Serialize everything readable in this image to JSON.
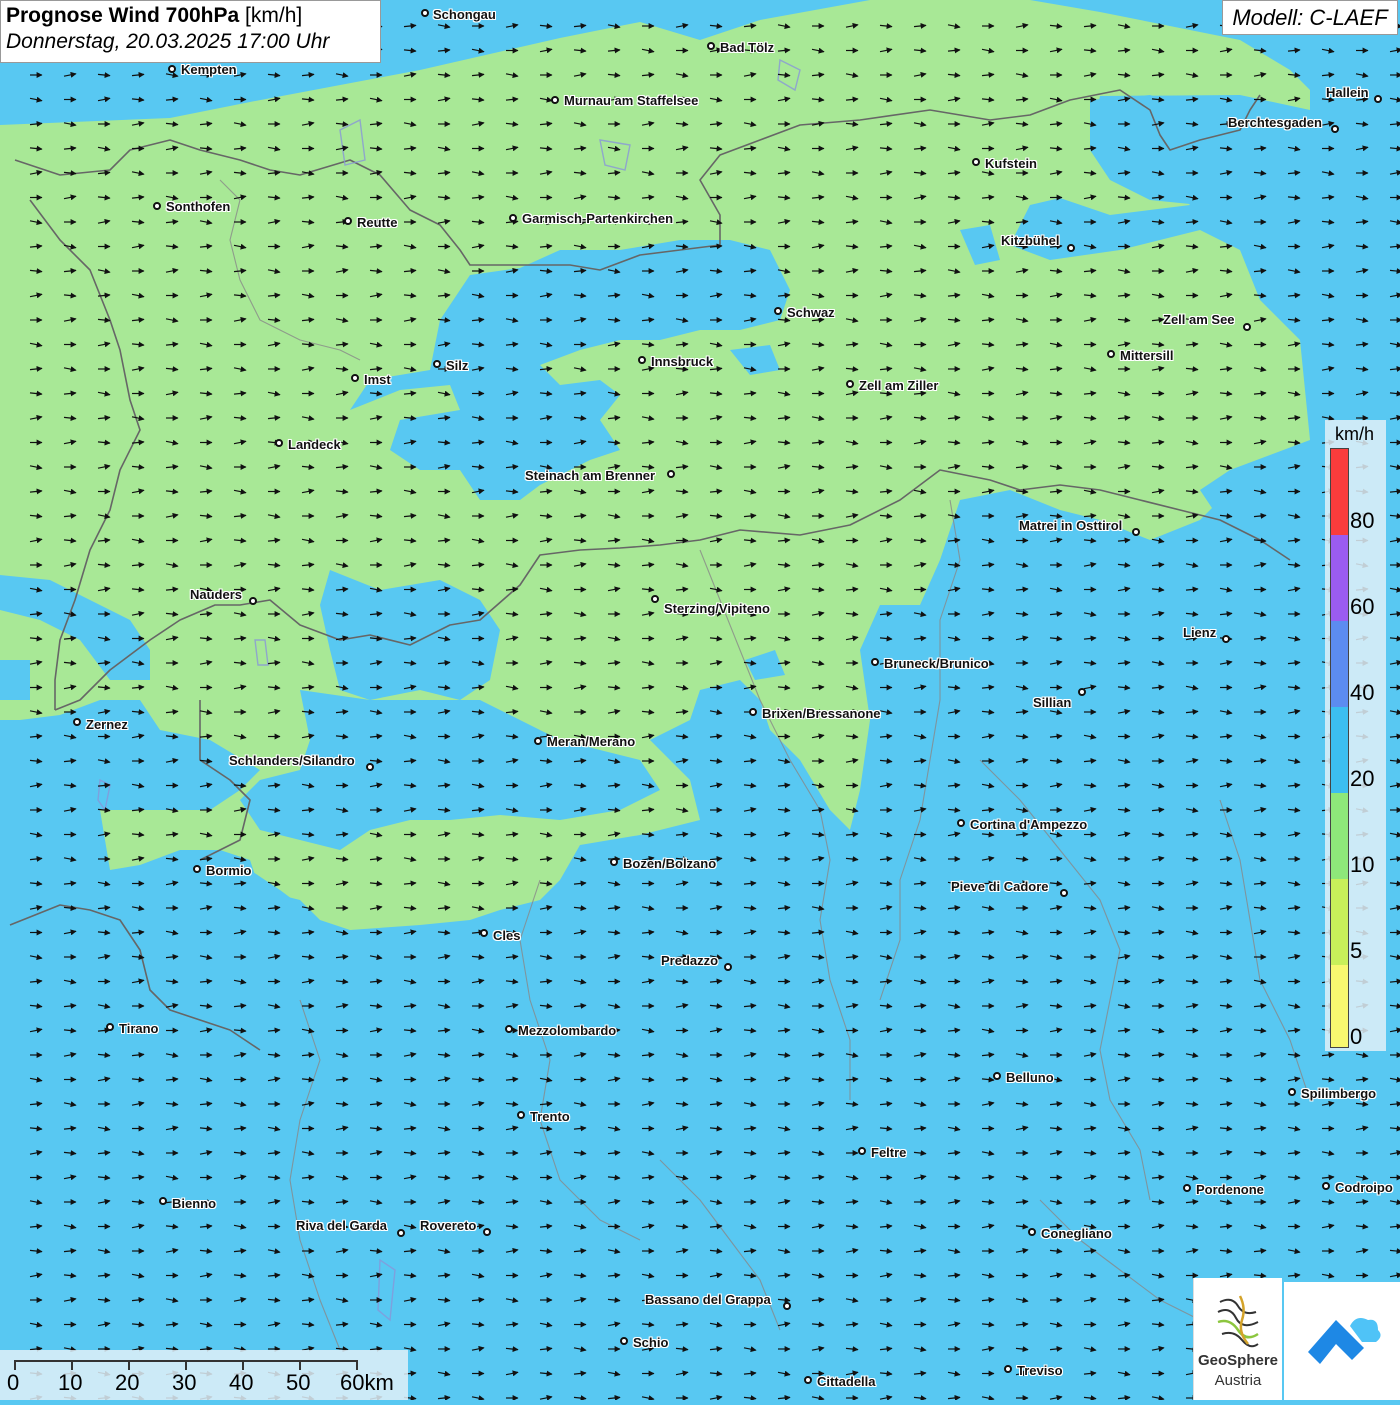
{
  "header": {
    "title_bold": "Prognose Wind 700hPa",
    "title_unit": "[km/h]",
    "datetime": "Donnerstag, 20.03.2025 17:00 Uhr",
    "model": "Modell: C-LAEF"
  },
  "legend": {
    "unit": "km/h",
    "labels": [
      "80",
      "60",
      "40",
      "20",
      "10",
      "5",
      "0"
    ],
    "colors": [
      "#fa3c3c",
      "#9b5cf0",
      "#5c8cf0",
      "#3cbef0",
      "#8ee87a",
      "#c8f05a",
      "#f8f870"
    ]
  },
  "scalebar": {
    "labels": [
      "0",
      "10",
      "20",
      "30",
      "40",
      "50",
      "60km"
    ]
  },
  "logos": {
    "geosphere_line1": "GeoSphere",
    "geosphere_line2": "Austria"
  },
  "field_colors": {
    "water_blue": "#58c8f2",
    "green": "#a8e896"
  },
  "cities": [
    {
      "name": "Schongau"
    },
    {
      "name": "Bad Tölz"
    },
    {
      "name": "Kempten"
    },
    {
      "name": "Murnau am Staffelsee"
    },
    {
      "name": "Hallein"
    },
    {
      "name": "Berchtesgaden"
    },
    {
      "name": "Kufstein"
    },
    {
      "name": "Sonthofen"
    },
    {
      "name": "Reutte"
    },
    {
      "name": "Garmisch-Partenkirchen"
    },
    {
      "name": "Kitzbühel"
    },
    {
      "name": "Schwaz"
    },
    {
      "name": "Zell am See"
    },
    {
      "name": "Mittersill"
    },
    {
      "name": "Silz"
    },
    {
      "name": "Innsbruck"
    },
    {
      "name": "Imst"
    },
    {
      "name": "Zell am Ziller"
    },
    {
      "name": "Landeck"
    },
    {
      "name": "Steinach am Brenner"
    },
    {
      "name": "Matrei in Osttirol"
    },
    {
      "name": "Nauders"
    },
    {
      "name": "Sterzing/Vipiteno"
    },
    {
      "name": "Lienz"
    },
    {
      "name": "Bruneck/Brunico"
    },
    {
      "name": "Sillian"
    },
    {
      "name": "Brixen/Bressanone"
    },
    {
      "name": "Zernez"
    },
    {
      "name": "Meran/Merano"
    },
    {
      "name": "Schlanders/Silandro"
    },
    {
      "name": "Cortina d'Ampezzo"
    },
    {
      "name": "Bozen/Bolzano"
    },
    {
      "name": "Bormio"
    },
    {
      "name": "Pieve di Cadore"
    },
    {
      "name": "Cles"
    },
    {
      "name": "Predazzo"
    },
    {
      "name": "Tirano"
    },
    {
      "name": "Mezzolombardo"
    },
    {
      "name": "Belluno"
    },
    {
      "name": "Spilimbergo"
    },
    {
      "name": "Trento"
    },
    {
      "name": "Feltre"
    },
    {
      "name": "Pordenone"
    },
    {
      "name": "Codroipo"
    },
    {
      "name": "Bienno"
    },
    {
      "name": "Riva del Garda"
    },
    {
      "name": "Rovereto"
    },
    {
      "name": "Conegliano"
    },
    {
      "name": "Bassano del Grappa"
    },
    {
      "name": "Schio"
    },
    {
      "name": "Treviso"
    },
    {
      "name": "Cittadella"
    }
  ]
}
